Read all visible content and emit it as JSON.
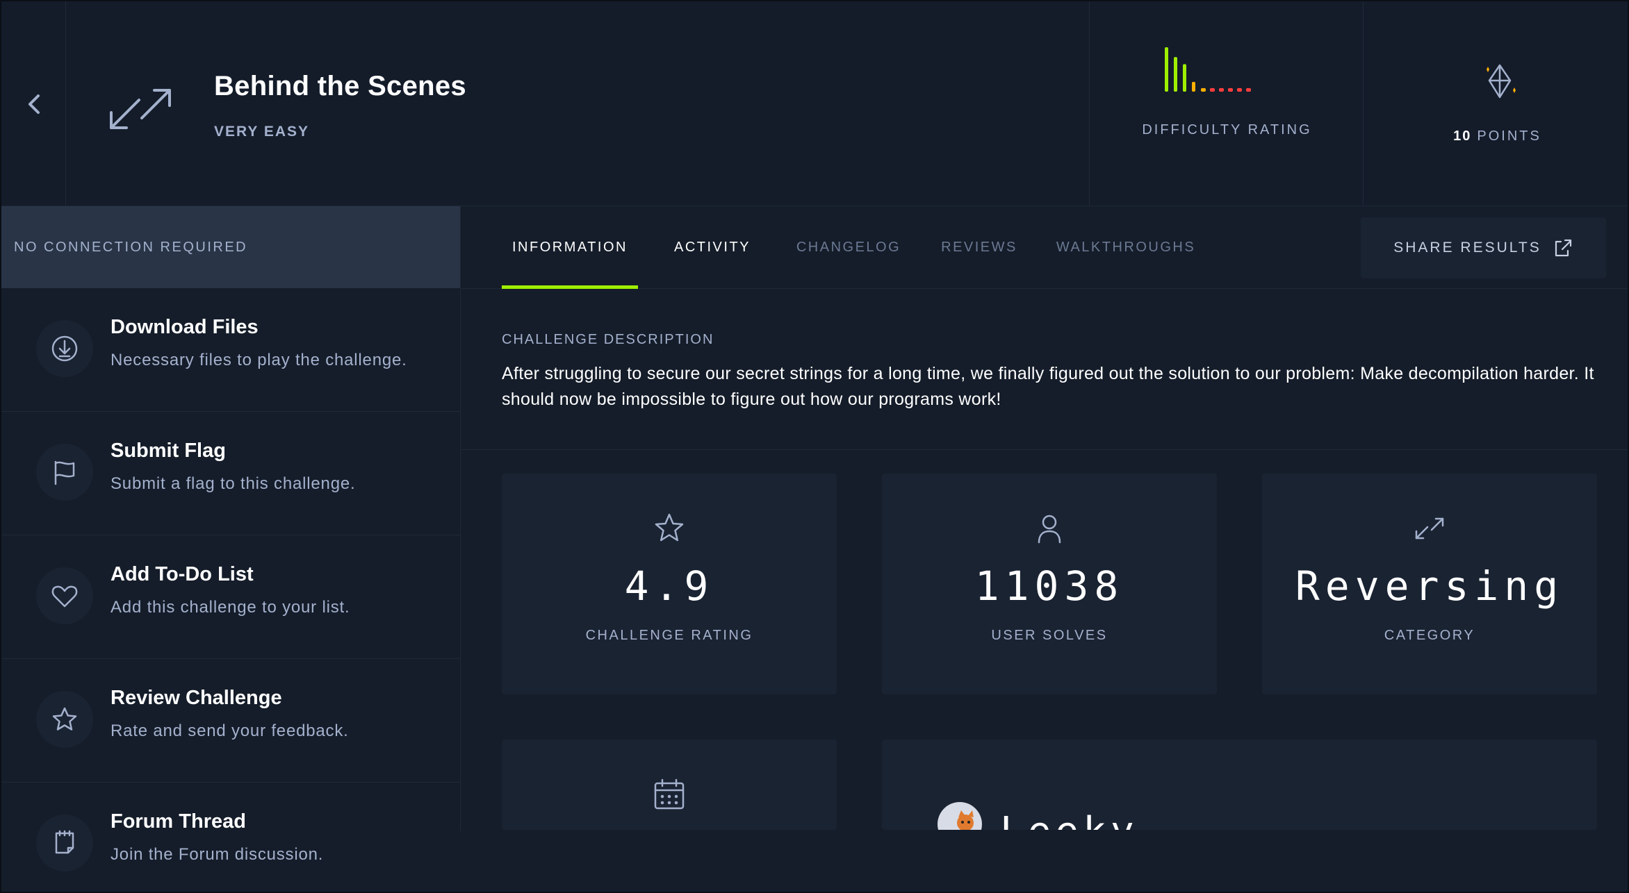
{
  "header": {
    "title": "Behind the Scenes",
    "level": "VERY EASY",
    "difficulty_label": "DIFFICULTY RATING",
    "difficulty_bars": [
      1.0,
      0.78,
      0.62,
      0.22,
      0.08,
      0.08,
      0.08,
      0.08,
      0.08,
      0.08
    ],
    "points_value": "10",
    "points_label": "POINTS"
  },
  "sidebar": {
    "connection": "NO CONNECTION REQUIRED",
    "actions": [
      {
        "title": "Download Files",
        "desc": "Necessary files to play the challenge.",
        "icon": "download-icon"
      },
      {
        "title": "Submit Flag",
        "desc": "Submit a flag to this challenge.",
        "icon": "flag-icon"
      },
      {
        "title": "Add To-Do List",
        "desc": "Add this challenge to your list.",
        "icon": "heart-icon"
      },
      {
        "title": "Review Challenge",
        "desc": "Rate and send your feedback.",
        "icon": "star-icon"
      },
      {
        "title": "Forum Thread",
        "desc": "Join the Forum discussion.",
        "icon": "forum-icon"
      }
    ]
  },
  "tabs": [
    "INFORMATION",
    "ACTIVITY",
    "CHANGELOG",
    "REVIEWS",
    "WALKTHROUGHS"
  ],
  "share_label": "SHARE RESULTS",
  "description": {
    "heading": "CHALLENGE DESCRIPTION",
    "text": "After struggling to secure our secret strings for a long time, we finally figured out the solution to our problem: Make decompilation harder. It should now be impossible to figure out how our programs work!"
  },
  "stats": [
    {
      "value": "4.9",
      "label": "CHALLENGE RATING",
      "icon": "star-icon"
    },
    {
      "value": "11038",
      "label": "USER SOLVES",
      "icon": "user-icon"
    },
    {
      "value": "Reversing",
      "label": "CATEGORY",
      "icon": "reversing-icon"
    }
  ],
  "author": {
    "name": "Leeky"
  },
  "colors": {
    "accent": "#9fef00",
    "bar_green": "#9fef00",
    "bar_orange": "#ffaf00",
    "bar_red": "#ff3e3e",
    "background": "#141d2b",
    "card": "#1a2332",
    "muted_text": "#a4b1cd"
  }
}
